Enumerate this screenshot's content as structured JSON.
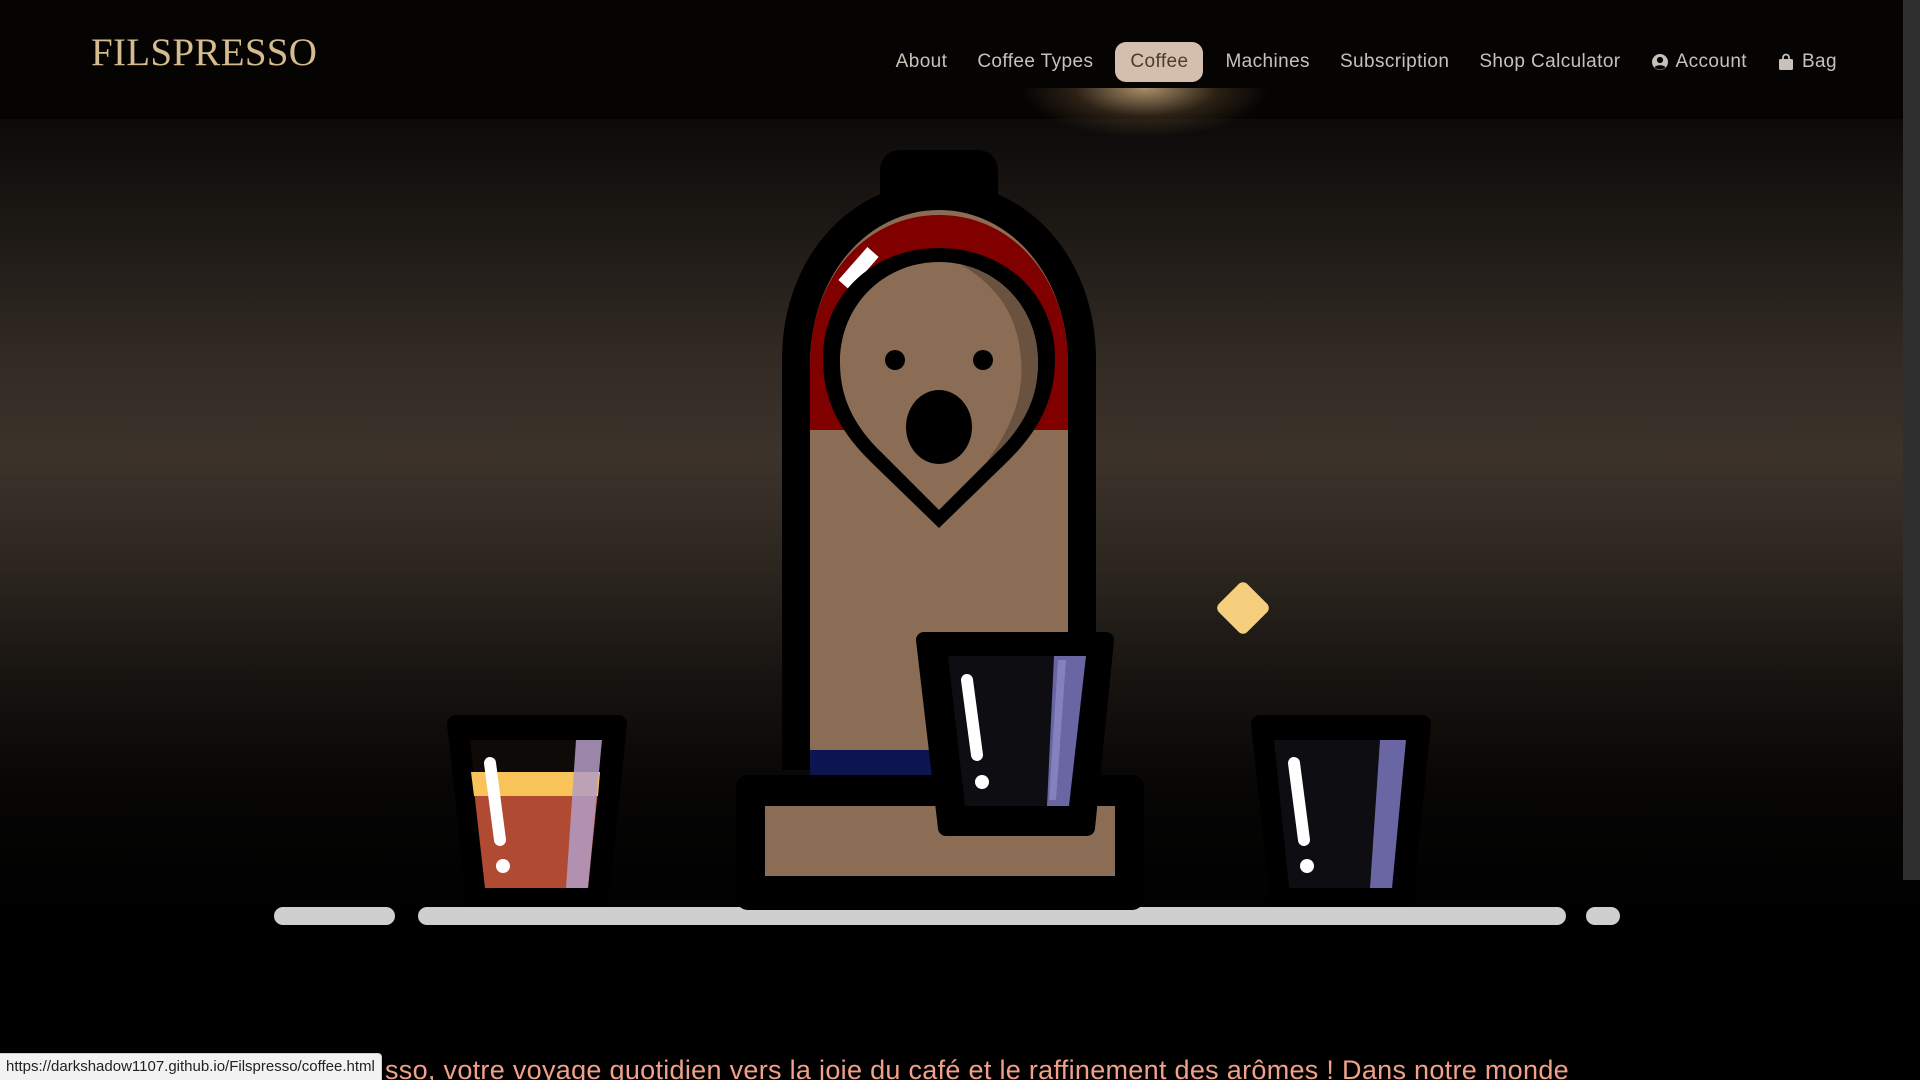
{
  "brand": "FILSPRESSO",
  "nav": {
    "about": "About",
    "coffee_types": "Coffee Types",
    "coffee": "Coffee",
    "machines": "Machines",
    "subscription": "Subscription",
    "shop_calculator": "Shop Calculator",
    "account": "Account",
    "bag": "Bag",
    "active": "Coffee"
  },
  "icons": {
    "account": "user-circle-icon",
    "bag": "shopping-bag-icon"
  },
  "hero": {
    "tagline": "sso, votre voyage quotidien vers la joie du café et le raffinement des arômes ! Dans notre monde"
  },
  "status_bar": {
    "url": "https://darkshadow1107.github.io/Filspresso/coffee.html"
  },
  "colors": {
    "brand": "#d5bb8d",
    "nav_text": "#c7c1b9",
    "active_pill": "#d4bfae",
    "tagline": "#f0a187",
    "machine_body": "#8a6d54",
    "machine_red": "#800000",
    "machine_navy": "#0d1550",
    "sparkle": "#f5cf7e"
  }
}
